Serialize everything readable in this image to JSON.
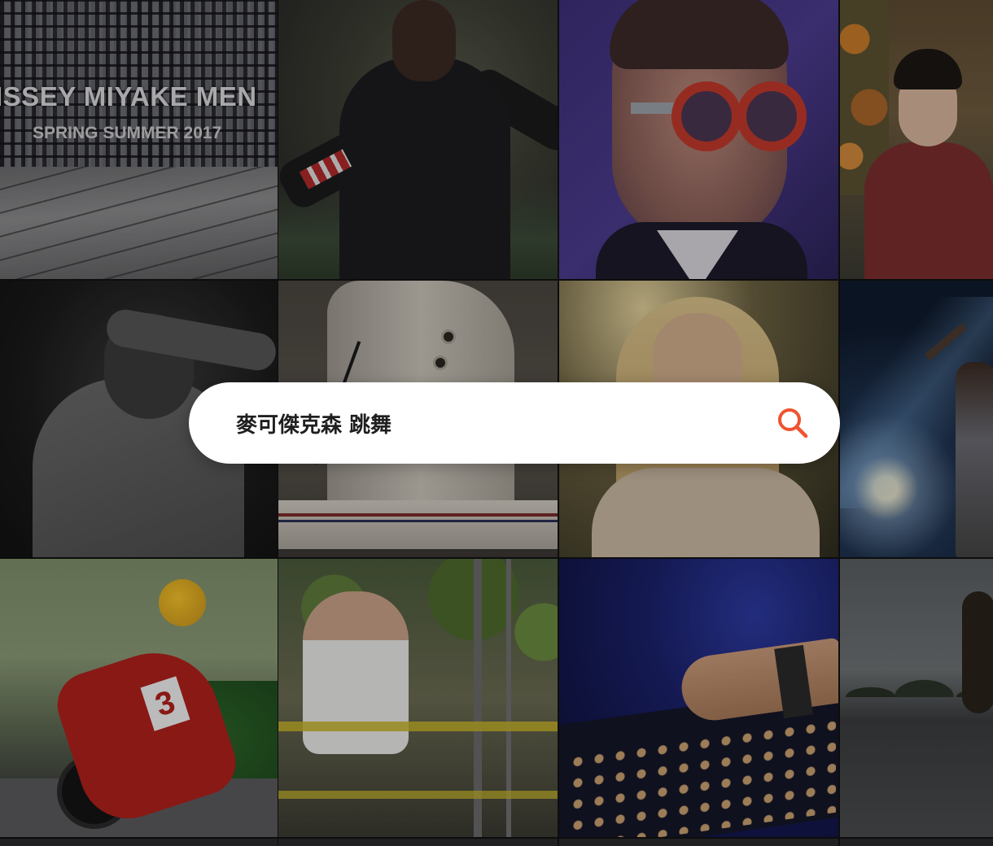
{
  "search": {
    "value": "麥可傑克森 跳舞",
    "icon": "search-icon",
    "accent_color": "#F0532F"
  },
  "tiles": {
    "issey": {
      "headline": "ISSEY MIYAKE MEN",
      "subline": "SPRING SUMMER 2017"
    },
    "motorcycle": {
      "number": "3"
    }
  }
}
